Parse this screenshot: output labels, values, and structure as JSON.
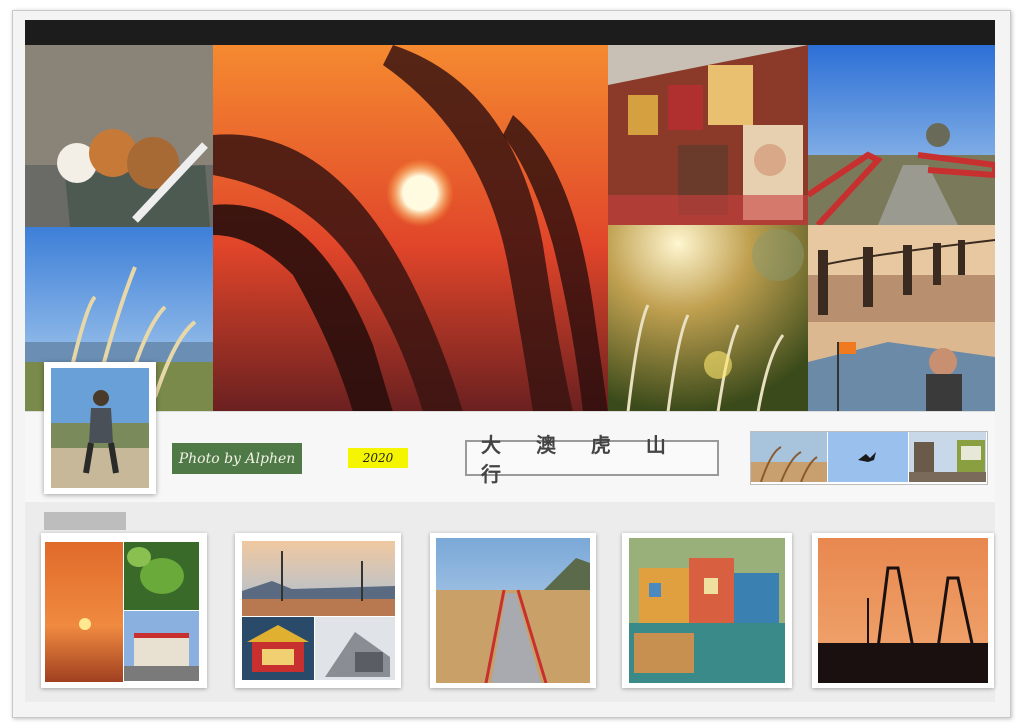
{
  "collage": {
    "credit_text": "Photo by Alphen",
    "year": "2020",
    "title": "大 澳 虎 山 行",
    "sections": {
      "main_collage": "photo grid: dogs in stroller, sunset reeds, poster wall, red-rail coastal path, reeds by the sea, glowing grass, harbor railing, traveller selfie",
      "middle_band": "portrait, credit, year, title, small photo strip",
      "bottom_row": "five framed photo cards"
    }
  },
  "colors": {
    "credit_bg": "#4f7a48",
    "year_bg": "#f5f500",
    "topbar": "#1c1c1c"
  }
}
